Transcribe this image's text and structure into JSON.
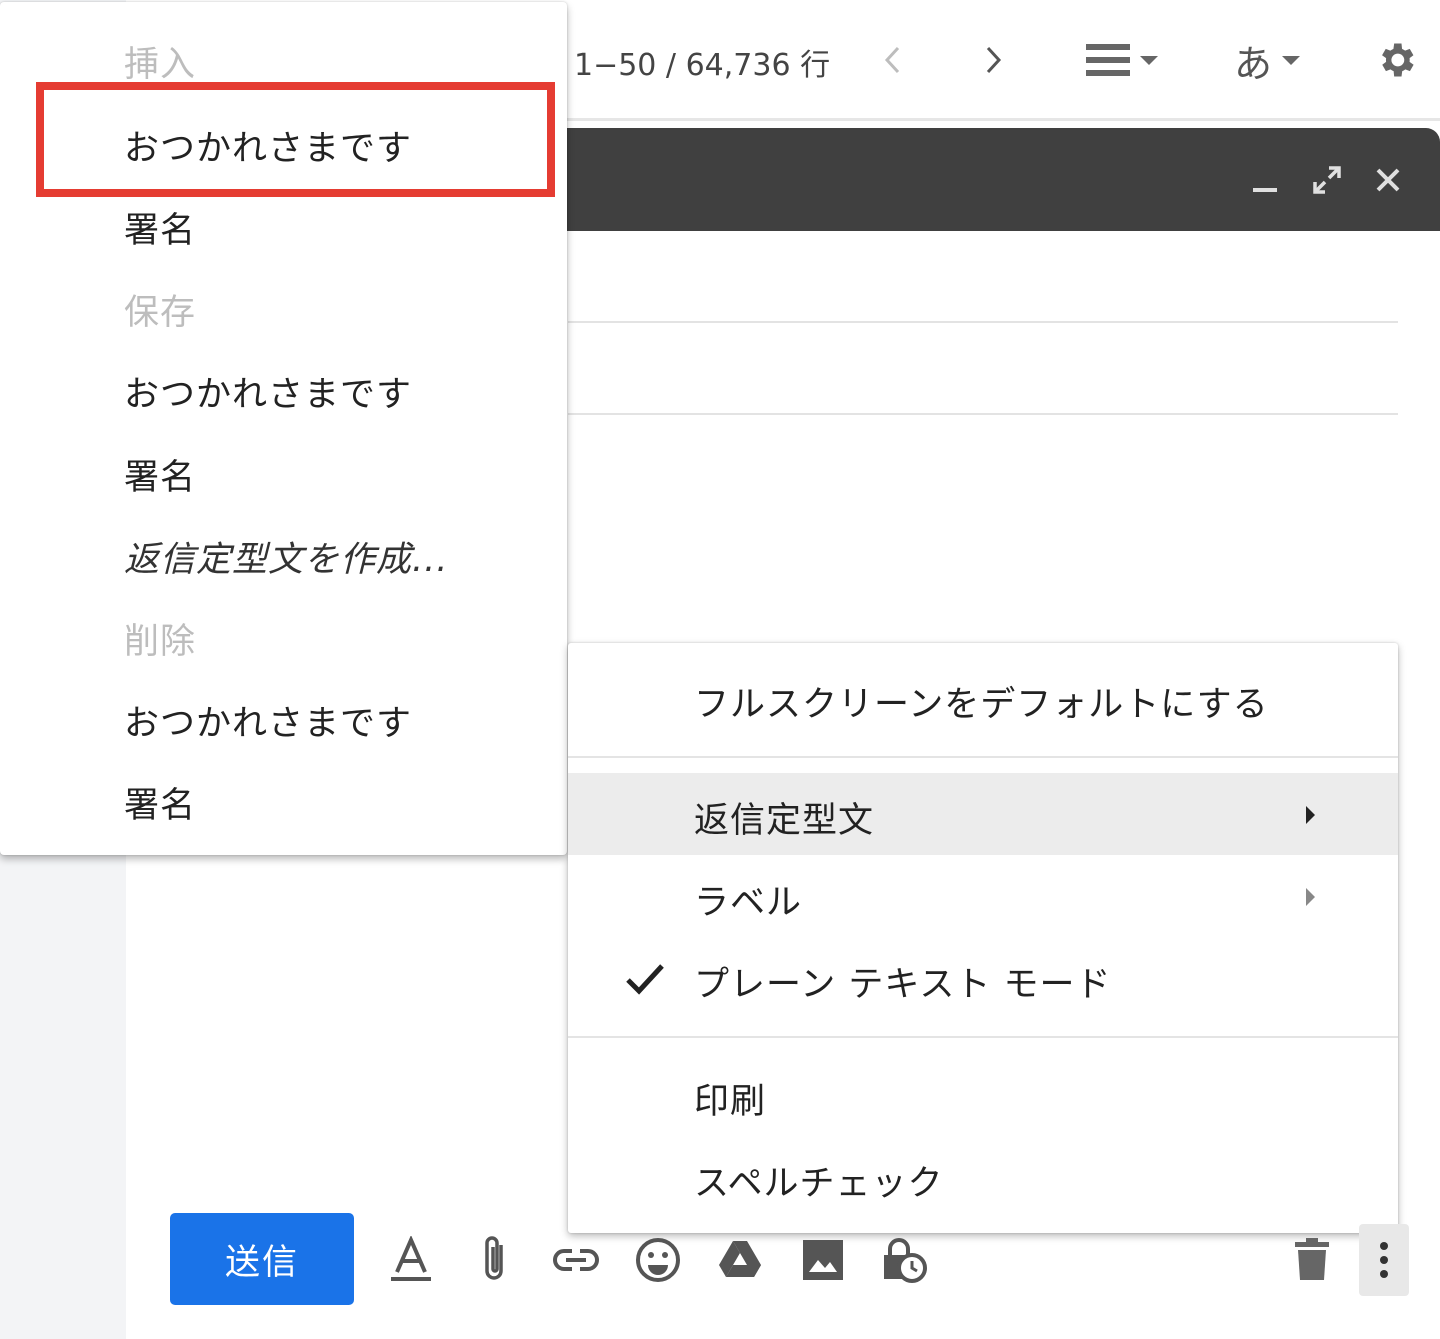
{
  "toolbar": {
    "count_label": "1−50 / 64,736 行",
    "input_tool_label": "あ",
    "icons": [
      "chevron-left-icon",
      "chevron-right-icon",
      "density-icon",
      "input-tools-icon",
      "gear-icon"
    ]
  },
  "compose": {
    "header_icons": [
      "minimize-icon",
      "expand-icon",
      "close-icon"
    ]
  },
  "templates_menu": {
    "insert_header": "挿入",
    "insert_items": [
      "おつかれさまです",
      "署名"
    ],
    "save_header": "保存",
    "save_items": [
      "おつかれさまです",
      "署名"
    ],
    "create_new": "返信定型文を作成...",
    "delete_header": "削除",
    "delete_items": [
      "おつかれさまです",
      "署名"
    ],
    "highlight_color": "#e53c32"
  },
  "more_menu": {
    "fullscreen_default": "フルスクリーンをデフォルトにする",
    "templates": "返信定型文",
    "label": "ラベル",
    "plain_text_mode": "プレーン テキスト モード",
    "plain_text_checked": true,
    "print": "印刷",
    "spell_check": "スペルチェック"
  },
  "bottom_bar": {
    "send_label": "送信",
    "send_color": "#1a73e8",
    "icons": [
      "format-text-icon",
      "attach-icon",
      "link-icon",
      "emoji-icon",
      "drive-icon",
      "photo-icon",
      "confidential-mode-icon",
      "trash-icon",
      "more-vert-icon"
    ]
  }
}
